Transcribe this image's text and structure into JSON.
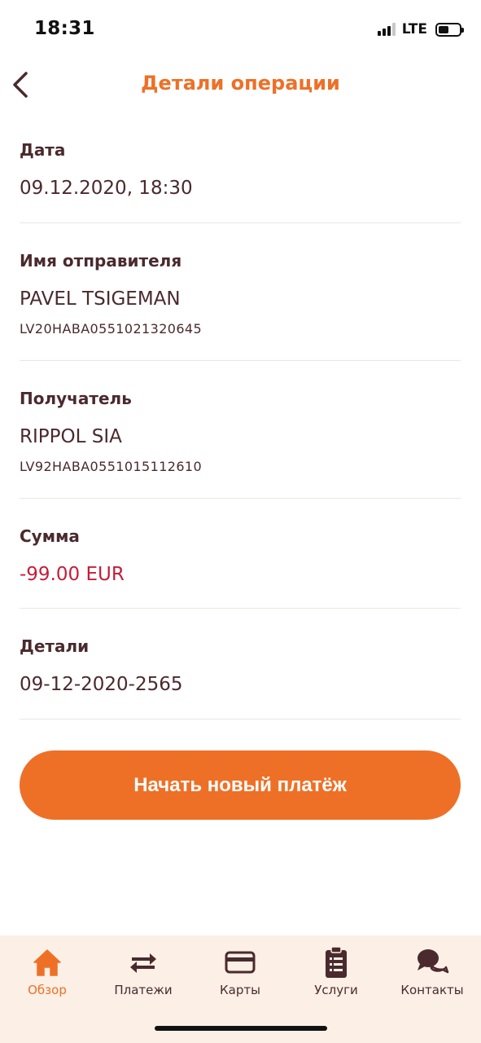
{
  "status_bar": {
    "time": "18:31",
    "network": "LTE"
  },
  "header": {
    "title": "Детали операции"
  },
  "details": {
    "date": {
      "label": "Дата",
      "value": "09.12.2020, 18:30"
    },
    "sender": {
      "label": "Имя отправителя",
      "name": "PAVEL TSIGEMAN",
      "account": "LV20HABA0551021320645"
    },
    "recipient": {
      "label": "Получатель",
      "name": "RIPPOL SIA",
      "account": "LV92HABA0551015112610"
    },
    "amount": {
      "label": "Сумма",
      "value": "-99.00 EUR"
    },
    "reference": {
      "label": "Детали",
      "value": "09-12-2020-2565"
    }
  },
  "actions": {
    "new_payment": "Начать новый платёж"
  },
  "tab_bar": {
    "items": [
      {
        "label": "Обзор",
        "icon": "home-icon",
        "active": true
      },
      {
        "label": "Платежи",
        "icon": "transfer-arrows-icon",
        "active": false
      },
      {
        "label": "Карты",
        "icon": "card-icon",
        "active": false
      },
      {
        "label": "Услуги",
        "icon": "clipboard-icon",
        "active": false
      },
      {
        "label": "Контакты",
        "icon": "chat-bubbles-icon",
        "active": false
      }
    ]
  },
  "colors": {
    "accent": "#ee7027",
    "text": "#4a2a2e",
    "negative": "#c41e3a",
    "tab_bar_bg": "#fbefe6"
  }
}
